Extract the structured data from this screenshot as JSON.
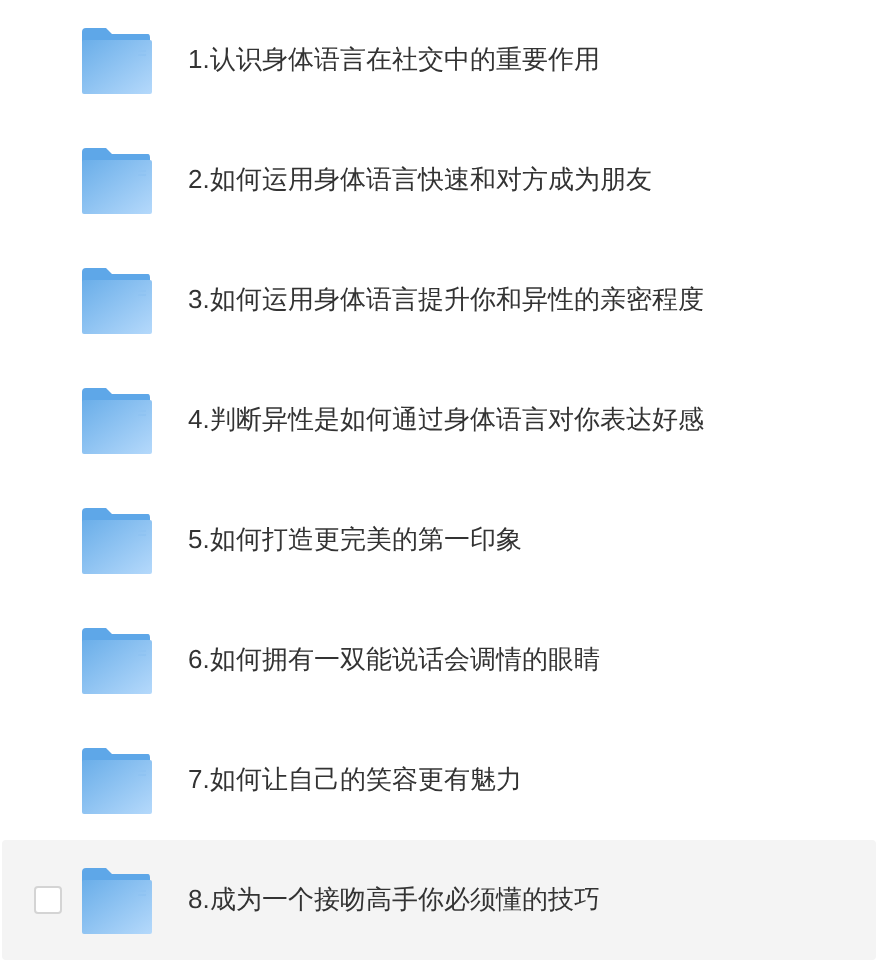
{
  "folders": [
    {
      "name": "1.认识身体语言在社交中的重要作用",
      "hovered": false,
      "checked": false
    },
    {
      "name": "2.如何运用身体语言快速和对方成为朋友",
      "hovered": false,
      "checked": false
    },
    {
      "name": "3.如何运用身体语言提升你和异性的亲密程度",
      "hovered": false,
      "checked": false
    },
    {
      "name": "4.判断异性是如何通过身体语言对你表达好感",
      "hovered": false,
      "checked": false
    },
    {
      "name": "5.如何打造更完美的第一印象",
      "hovered": false,
      "checked": false
    },
    {
      "name": "6.如何拥有一双能说话会调情的眼睛",
      "hovered": false,
      "checked": false
    },
    {
      "name": "7.如何让自己的笑容更有魅力",
      "hovered": false,
      "checked": false
    },
    {
      "name": "8.成为一个接吻高手你必须懂的技巧",
      "hovered": true,
      "checked": false
    }
  ]
}
